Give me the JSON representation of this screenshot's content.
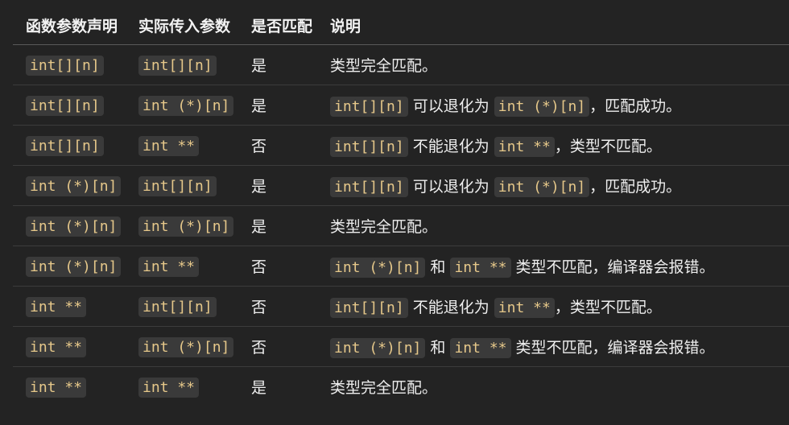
{
  "headers": [
    "函数参数声明",
    "实际传入参数",
    "是否匹配",
    "说明"
  ],
  "rows": [
    {
      "decl": "int[][n]",
      "arg": "int[][n]",
      "match": "是",
      "note": [
        {
          "t": "类型完全匹配。"
        }
      ]
    },
    {
      "decl": "int[][n]",
      "arg": "int (*)[n]",
      "match": "是",
      "note": [
        {
          "c": "int[][n]"
        },
        {
          "t": " 可以退化为 "
        },
        {
          "c": "int (*)[n]"
        },
        {
          "t": "，匹配成功。"
        }
      ]
    },
    {
      "decl": "int[][n]",
      "arg": "int **",
      "match": "否",
      "note": [
        {
          "c": "int[][n]"
        },
        {
          "t": " 不能退化为 "
        },
        {
          "c": "int **"
        },
        {
          "t": "，类型不匹配。"
        }
      ]
    },
    {
      "decl": "int (*)[n]",
      "arg": "int[][n]",
      "match": "是",
      "note": [
        {
          "c": "int[][n]"
        },
        {
          "t": " 可以退化为 "
        },
        {
          "c": "int (*)[n]"
        },
        {
          "t": "，匹配成功。"
        }
      ]
    },
    {
      "decl": "int (*)[n]",
      "arg": "int (*)[n]",
      "match": "是",
      "note": [
        {
          "t": "类型完全匹配。"
        }
      ]
    },
    {
      "decl": "int (*)[n]",
      "arg": "int **",
      "match": "否",
      "note": [
        {
          "c": "int (*)[n]"
        },
        {
          "t": " 和 "
        },
        {
          "c": "int **"
        },
        {
          "t": " 类型不匹配，编译器会报错。"
        }
      ]
    },
    {
      "decl": "int **",
      "arg": "int[][n]",
      "match": "否",
      "note": [
        {
          "c": "int[][n]"
        },
        {
          "t": " 不能退化为 "
        },
        {
          "c": "int **"
        },
        {
          "t": "，类型不匹配。"
        }
      ]
    },
    {
      "decl": "int **",
      "arg": "int (*)[n]",
      "match": "否",
      "note": [
        {
          "c": "int (*)[n]"
        },
        {
          "t": " 和 "
        },
        {
          "c": "int **"
        },
        {
          "t": " 类型不匹配，编译器会报错。"
        }
      ]
    },
    {
      "decl": "int **",
      "arg": "int **",
      "match": "是",
      "note": [
        {
          "t": "类型完全匹配。"
        }
      ]
    }
  ]
}
